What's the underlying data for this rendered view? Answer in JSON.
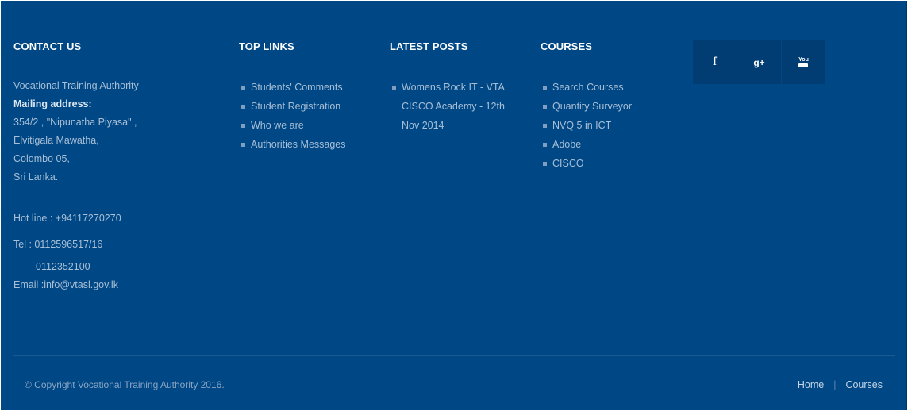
{
  "contact": {
    "heading": "CONTACT US",
    "org": "Vocational Training Authority",
    "mailing_label": "Mailing address:",
    "address_lines": [
      "354/2 , \"Nipunatha Piyasa\" ,",
      "Elvitigala Mawatha,",
      "Colombo 05,",
      "Sri Lanka."
    ],
    "hotline": "Hot line : +94117270270",
    "tel": "Tel : 0112596517/16",
    "tel2": "0112352100",
    "email": "Email :info@vtasl.gov.lk"
  },
  "top_links": {
    "heading": "TOP LINKS",
    "items": [
      "Students' Comments",
      "Student Registration",
      "Who we are",
      "Authorities Messages"
    ]
  },
  "latest_posts": {
    "heading": "LATEST POSTS",
    "items": [
      "Womens Rock IT - VTA CISCO Academy - 12th Nov 2014"
    ]
  },
  "courses": {
    "heading": "COURSES",
    "items": [
      "Search Courses",
      "Quantity Surveyor",
      "NVQ 5 in ICT",
      "Adobe",
      "CISCO"
    ]
  },
  "social": [
    {
      "icon": "facebook-icon",
      "glyph": "f"
    },
    {
      "icon": "google-plus-icon",
      "glyph": "g+"
    },
    {
      "icon": "youtube-icon",
      "glyph": "You"
    }
  ],
  "footer": {
    "copyright": "© Copyright Vocational Training Authority 2016.",
    "nav": [
      "Home",
      "Courses"
    ]
  },
  "colors": {
    "background": "#004785",
    "social_bg": "#013c72",
    "text": "#a8bfd6"
  }
}
